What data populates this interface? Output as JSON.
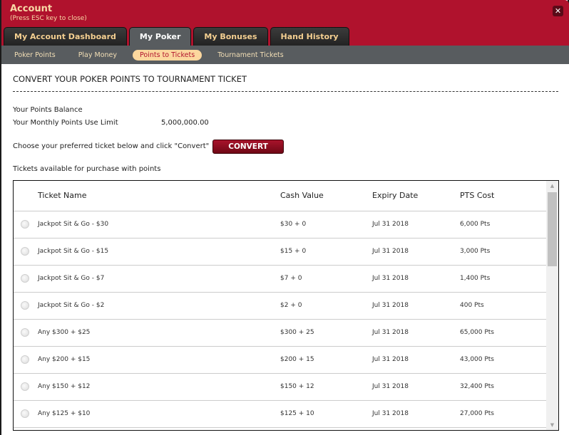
{
  "window": {
    "title": "Account",
    "subtitle": "(Press ESC key to close)",
    "close_icon": "close-icon"
  },
  "tabs": [
    {
      "label": "My Account Dashboard",
      "active": false
    },
    {
      "label": "My Poker",
      "active": true
    },
    {
      "label": "My Bonuses",
      "active": false
    },
    {
      "label": "Hand History",
      "active": false
    }
  ],
  "subnav": [
    {
      "label": "Poker Points",
      "active": false
    },
    {
      "label": "Play Money",
      "active": false
    },
    {
      "label": "Points to Tickets",
      "active": true
    },
    {
      "label": "Tournament Tickets",
      "active": false
    }
  ],
  "main": {
    "heading": "CONVERT YOUR POKER POINTS TO TOURNAMENT TICKET",
    "points_balance_label": "Your Points Balance",
    "points_balance_value": "",
    "monthly_limit_label": "Your Monthly Points Use Limit",
    "monthly_limit_value": "5,000,000.00",
    "instruction": "Choose your preferred ticket below and click \"Convert\"",
    "convert_label": "CONVERT",
    "tickets_label": "Tickets available for purchase with points"
  },
  "table": {
    "headers": [
      "Ticket Name",
      "Cash Value",
      "Expiry Date",
      "PTS Cost"
    ],
    "rows": [
      {
        "name": "Jackpot Sit & Go - $30",
        "cash": "$30 + 0",
        "expiry": "Jul 31 2018",
        "cost": "6,000 Pts"
      },
      {
        "name": "Jackpot Sit & Go - $15",
        "cash": "$15 + 0",
        "expiry": "Jul 31 2018",
        "cost": "3,000 Pts"
      },
      {
        "name": "Jackpot Sit & Go - $7",
        "cash": "$7 + 0",
        "expiry": "Jul 31 2018",
        "cost": "1,400 Pts"
      },
      {
        "name": "Jackpot Sit & Go - $2",
        "cash": "$2 + 0",
        "expiry": "Jul 31 2018",
        "cost": "400 Pts"
      },
      {
        "name": "Any $300 + $25",
        "cash": "$300 + 25",
        "expiry": "Jul 31 2018",
        "cost": "65,000 Pts"
      },
      {
        "name": "Any $200 + $15",
        "cash": "$200 + 15",
        "expiry": "Jul 31 2018",
        "cost": "43,000 Pts"
      },
      {
        "name": "Any $150 + $12",
        "cash": "$150 + 12",
        "expiry": "Jul 31 2018",
        "cost": "32,400 Pts"
      },
      {
        "name": "Any $125 + $10",
        "cash": "$125 + 10",
        "expiry": "Jul 31 2018",
        "cost": "27,000 Pts"
      }
    ]
  },
  "colors": {
    "header_red": "#b0122d",
    "tab_text": "#f4cf91",
    "subnav_bg": "#585c5f",
    "active_pill": "#fcd79e",
    "convert_button": "#a8132b"
  }
}
